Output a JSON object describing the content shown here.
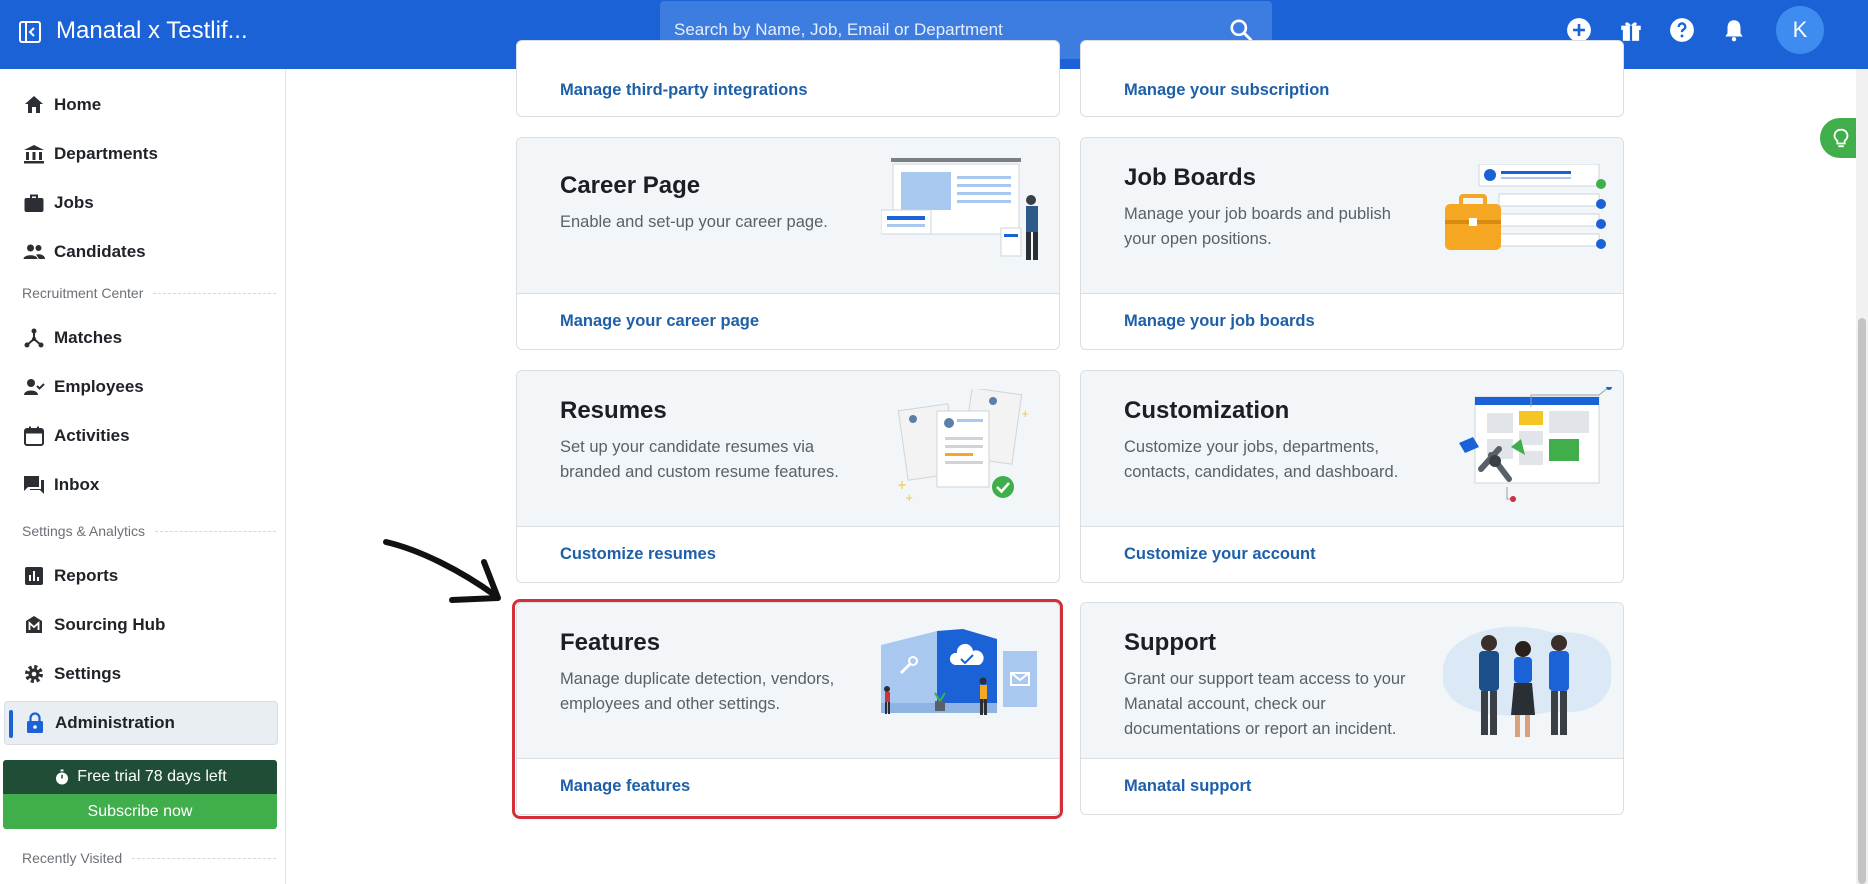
{
  "header": {
    "app_title": "Manatal x Testlif...",
    "search_placeholder": "Search by Name, Job, Email or Department",
    "avatar_initial": "K"
  },
  "sidebar": {
    "items_top": [
      {
        "label": "Home",
        "icon": "home-icon"
      },
      {
        "label": "Departments",
        "icon": "bank-icon"
      },
      {
        "label": "Jobs",
        "icon": "briefcase-icon"
      },
      {
        "label": "Candidates",
        "icon": "people-icon"
      }
    ],
    "section_recruitment": "Recruitment Center",
    "items_recruitment": [
      {
        "label": "Matches",
        "icon": "hub-icon"
      },
      {
        "label": "Employees",
        "icon": "person-check-icon"
      },
      {
        "label": "Activities",
        "icon": "calendar-icon"
      },
      {
        "label": "Inbox",
        "icon": "chat-icon"
      }
    ],
    "section_settings": "Settings & Analytics",
    "items_settings": [
      {
        "label": "Reports",
        "icon": "bar-chart-icon"
      },
      {
        "label": "Sourcing Hub",
        "icon": "sourcing-icon"
      },
      {
        "label": "Settings",
        "icon": "gear-icon"
      },
      {
        "label": "Administration",
        "icon": "lock-icon",
        "active": true
      }
    ],
    "trial_text": "Free trial 78 days left",
    "subscribe_label": "Subscribe now",
    "section_recent": "Recently Visited"
  },
  "cards": {
    "integrations_link": "Manage third-party integrations",
    "subscription_link": "Manage your subscription",
    "career": {
      "title": "Career Page",
      "desc": "Enable and set-up your career page.",
      "link": "Manage your career page"
    },
    "jobboards": {
      "title": "Job Boards",
      "desc": "Manage your job boards and publish your open positions.",
      "link": "Manage your job boards"
    },
    "resumes": {
      "title": "Resumes",
      "desc": "Set up your candidate resumes via branded and custom resume features.",
      "link": "Customize resumes"
    },
    "customization": {
      "title": "Customization",
      "desc": "Customize your jobs, departments, contacts, candidates, and dashboard.",
      "link": "Customize your account"
    },
    "features": {
      "title": "Features",
      "desc": "Manage duplicate detection, vendors, employees and other settings.",
      "link": "Manage features"
    },
    "support": {
      "title": "Support",
      "desc": "Grant our support team access to your Manatal account, check our documentations or report an incident.",
      "link": "Manatal support"
    }
  },
  "colors": {
    "brand": "#1a62d6",
    "link": "#1e5fa8",
    "highlight": "#d32f3a",
    "trial_bg": "#1f4d35",
    "subscribe_bg": "#3fae4b"
  }
}
